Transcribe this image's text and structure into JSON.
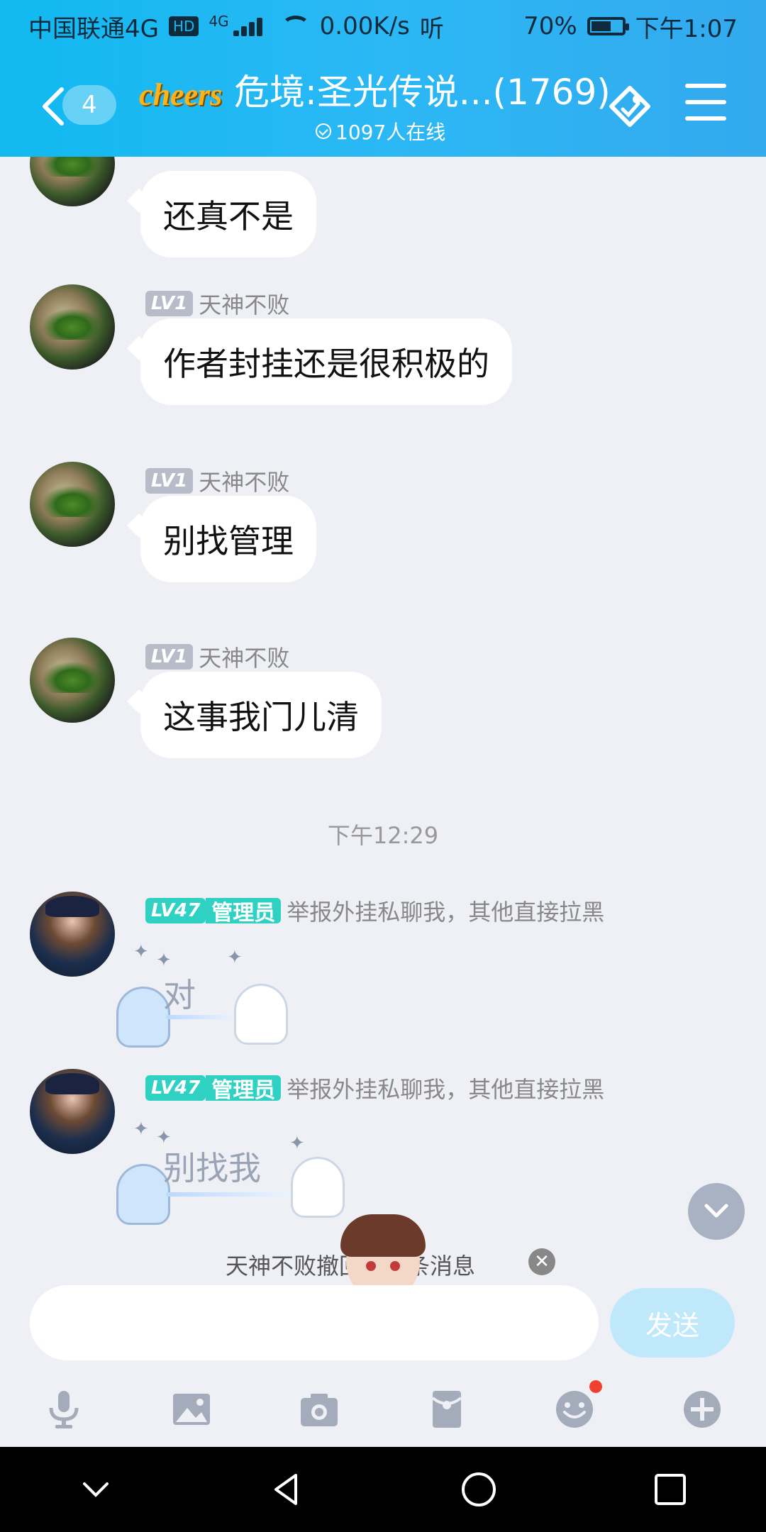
{
  "status_bar": {
    "carrier": "中国联通4G",
    "hd": "HD",
    "net_type": "4G",
    "speed": "0.00K/s",
    "extra_icon": "听",
    "battery": "70%",
    "time": "下午1:07"
  },
  "header": {
    "unread_count": "4",
    "logo_text": "cheers",
    "title": "危境:圣光传说...(1769)",
    "online_text": "1097人在线"
  },
  "messages": [
    {
      "sender": "",
      "level": "",
      "text": "还真不是"
    },
    {
      "sender": "天神不败",
      "level": "LV1",
      "text": "作者封挂还是很积极的"
    },
    {
      "sender": "天神不败",
      "level": "LV1",
      "text": "别找管理"
    },
    {
      "sender": "天神不败",
      "level": "LV1",
      "text": "这事我门儿清"
    }
  ],
  "timestamp": "下午12:29",
  "admin_messages": [
    {
      "level": "LV47",
      "role": "管理员",
      "sender": "举报外挂私聊我，其他直接拉黑",
      "sticker_text": "对"
    },
    {
      "level": "LV47",
      "role": "管理员",
      "sender": "举报外挂私聊我，其他直接拉黑",
      "sticker_text": "别找我"
    }
  ],
  "notice": {
    "text": "天神不败撤回了一条消息"
  },
  "input": {
    "placeholder": "",
    "send_label": "发送"
  },
  "toolbar": [
    "mic-icon",
    "image-icon",
    "camera-icon",
    "redpacket-icon",
    "emoji-icon",
    "plus-icon"
  ],
  "colors": {
    "header_start": "#11b9f0",
    "header_end": "#33a9ee",
    "admin_badge": "#2fd1c2",
    "send_disabled": "#bfe9fb"
  }
}
